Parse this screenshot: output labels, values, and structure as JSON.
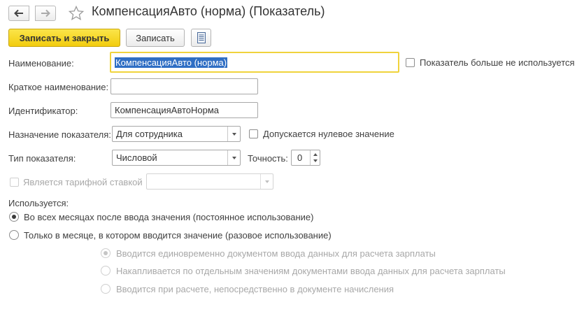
{
  "header": {
    "title": "КомпенсацияАвто (норма) (Показатель)",
    "back_icon": "arrow-left-icon",
    "forward_icon": "arrow-right-icon",
    "favorite_icon": "star-icon"
  },
  "toolbar": {
    "save_close_label": "Записать и закрыть",
    "save_label": "Записать",
    "doc_icon": "document-list-icon"
  },
  "form": {
    "name_label": "Наименование:",
    "name_value": "КомпенсацияАвто (норма)",
    "not_used_label": "Показатель больше не используется",
    "short_name_label": "Краткое наименование:",
    "short_name_value": "",
    "identifier_label": "Идентификатор:",
    "identifier_value": "КомпенсацияАвтоНорма",
    "purpose_label": "Назначение показателя:",
    "purpose_value": "Для сотрудника",
    "zero_allowed_label": "Допускается нулевое значение",
    "type_label": "Тип показателя:",
    "type_value": "Числовой",
    "precision_label": "Точность:",
    "precision_value": "0",
    "tariff_label": "Является тарифной ставкой",
    "tariff_value": "",
    "usage_label": "Используется:",
    "usage_options": [
      "Во всех месяцах после ввода значения (постоянное использование)",
      "Только в месяце, в котором вводится значение (разовое использование)"
    ],
    "sub_options": [
      "Вводится единовременно документом ввода данных для расчета зарплаты",
      "Накапливается по отдельным значениям документами ввода данных для расчета зарплаты",
      "Вводится при расчете, непосредственно в документе начисления"
    ]
  },
  "colors": {
    "primary_button": "#f5d31a",
    "selection": "#2f6ec4",
    "focus_border": "#f0d33c"
  }
}
